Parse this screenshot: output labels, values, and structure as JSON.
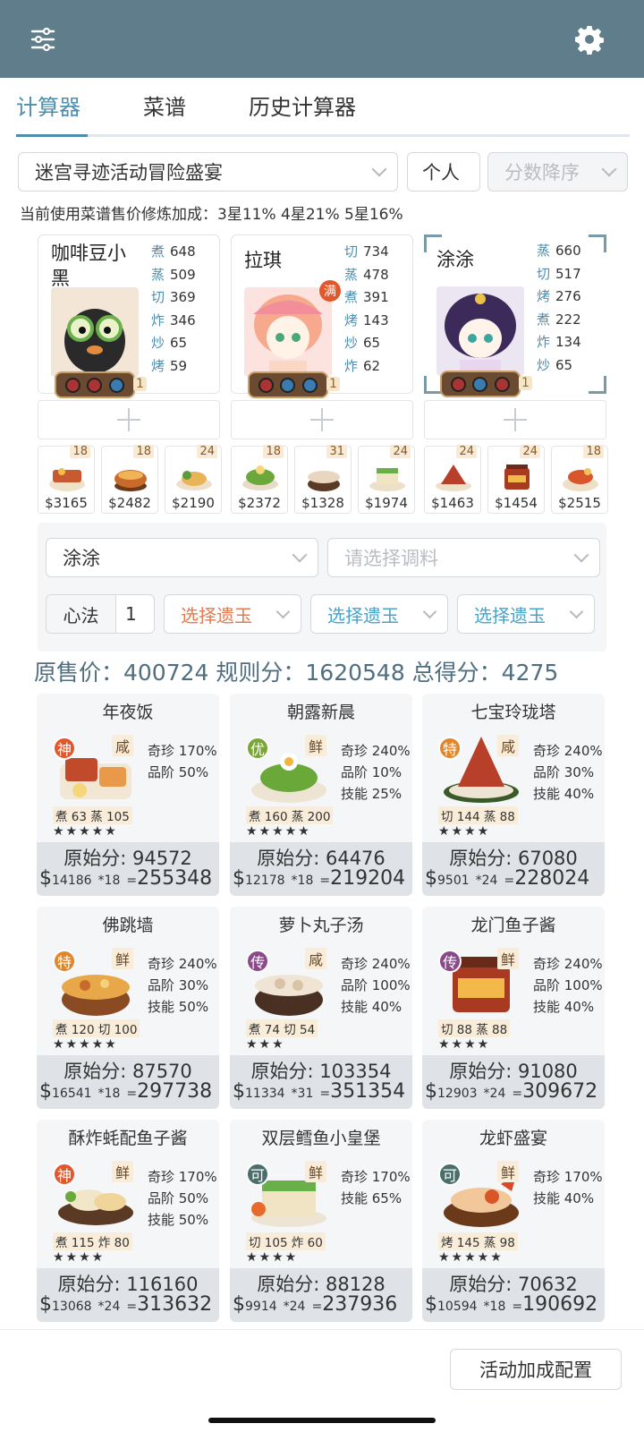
{
  "header": {
    "menu_icon": "sliders-icon",
    "settings_icon": "gear-icon"
  },
  "tabs": [
    "计算器",
    "菜谱",
    "历史计算器"
  ],
  "filters": {
    "event": "迷宫寻迹活动冒险盛宴",
    "mode": "个人",
    "sort": "分数降序"
  },
  "note": "当前使用菜谱售价修炼加成：3星11% 4星21% 5星16%",
  "chefs": [
    {
      "name": "咖啡豆小黑",
      "level": "1",
      "skills": [
        {
          "k": "煮",
          "v": "648"
        },
        {
          "k": "蒸",
          "v": "509"
        },
        {
          "k": "切",
          "v": "369"
        },
        {
          "k": "炸",
          "v": "346"
        },
        {
          "k": "炒",
          "v": "65"
        },
        {
          "k": "烤",
          "v": "59"
        }
      ]
    },
    {
      "name": "拉琪",
      "level": "1",
      "badge": "满",
      "skills": [
        {
          "k": "切",
          "v": "734"
        },
        {
          "k": "蒸",
          "v": "478"
        },
        {
          "k": "煮",
          "v": "391"
        },
        {
          "k": "烤",
          "v": "143"
        },
        {
          "k": "炒",
          "v": "65"
        },
        {
          "k": "炸",
          "v": "62"
        }
      ]
    },
    {
      "name": "涂涂",
      "level": "1",
      "skills": [
        {
          "k": "蒸",
          "v": "660"
        },
        {
          "k": "切",
          "v": "517"
        },
        {
          "k": "烤",
          "v": "276"
        },
        {
          "k": "煮",
          "v": "222"
        },
        {
          "k": "炸",
          "v": "134"
        },
        {
          "k": "炒",
          "v": "65"
        }
      ]
    }
  ],
  "recipes": [
    {
      "count": "18",
      "price": "$3165"
    },
    {
      "count": "18",
      "price": "$2482"
    },
    {
      "count": "24",
      "price": "$2190"
    },
    {
      "count": "18",
      "price": "$2372"
    },
    {
      "count": "31",
      "price": "$1328"
    },
    {
      "count": "24",
      "price": "$1974"
    },
    {
      "count": "24",
      "price": "$1463"
    },
    {
      "count": "24",
      "price": "$1454"
    },
    {
      "count": "18",
      "price": "$2515"
    }
  ],
  "panel": {
    "chef": "涂涂",
    "condiment_placeholder": "请选择调料",
    "xinfa_label": "心法",
    "xinfa_value": "1",
    "relic1": "选择遗玉",
    "relic2": "选择遗玉",
    "relic3": "选择遗玉"
  },
  "summary": "原售价：400724 规则分：1620548 总得分：4275",
  "dishes": [
    {
      "name": "年夜饭",
      "rarity": "神",
      "taste": "咸",
      "bonus": [
        "奇珍 170%",
        "品阶 50%"
      ],
      "skills": "煮 63 蒸 105",
      "stars": "★★★★★",
      "orig": "原始分: 94572",
      "unit": "14186",
      "mult": "*18",
      "total": "255348"
    },
    {
      "name": "朝露新晨",
      "rarity": "优",
      "taste": "鲜",
      "bonus": [
        "奇珍 240%",
        "品阶 10%",
        "技能 25%"
      ],
      "skills": "煮 160 蒸 200",
      "stars": "★★★★★",
      "orig": "原始分: 64476",
      "unit": "12178",
      "mult": "*18",
      "total": "219204"
    },
    {
      "name": "七宝玲珑塔",
      "rarity": "特",
      "taste": "咸",
      "bonus": [
        "奇珍 240%",
        "品阶 30%",
        "技能 40%"
      ],
      "skills": "切 144 蒸 88",
      "stars": "★★★★",
      "orig": "原始分: 67080",
      "unit": "9501",
      "mult": "*24",
      "total": "228024"
    },
    {
      "name": "佛跳墙",
      "rarity": "特",
      "taste": "鲜",
      "bonus": [
        "奇珍 240%",
        "品阶 30%",
        "技能 50%"
      ],
      "skills": "煮 120 切 100",
      "stars": "★★★★★",
      "orig": "原始分: 87570",
      "unit": "16541",
      "mult": "*18",
      "total": "297738"
    },
    {
      "name": "萝卜丸子汤",
      "rarity": "传",
      "taste": "咸",
      "bonus": [
        "奇珍 240%",
        "品阶 100%",
        "技能 40%"
      ],
      "skills": "煮 74 切 54",
      "stars": "★★★",
      "orig": "原始分: 103354",
      "unit": "11334",
      "mult": "*31",
      "total": "351354"
    },
    {
      "name": "龙门鱼子酱",
      "rarity": "传",
      "taste": "鲜",
      "bonus": [
        "奇珍 240%",
        "品阶 100%",
        "技能 40%"
      ],
      "skills": "切 88 蒸 88",
      "stars": "★★★★",
      "orig": "原始分: 91080",
      "unit": "12903",
      "mult": "*24",
      "total": "309672"
    },
    {
      "name": "酥炸蚝配鱼子酱",
      "rarity": "神",
      "taste": "鲜",
      "bonus": [
        "奇珍 170%",
        "品阶 50%",
        "技能 50%"
      ],
      "skills": "煮 115 炸 80",
      "stars": "★★★★",
      "orig": "原始分: 116160",
      "unit": "13068",
      "mult": "*24",
      "total": "313632"
    },
    {
      "name": "双层鳕鱼小皇堡",
      "rarity": "可",
      "taste": "鲜",
      "bonus": [
        "奇珍 170%",
        "技能 65%"
      ],
      "skills": "切 105 炸 60",
      "stars": "★★★★",
      "orig": "原始分: 88128",
      "unit": "9914",
      "mult": "*24",
      "total": "237936"
    },
    {
      "name": "龙虾盛宴",
      "rarity": "可",
      "taste": "鲜",
      "bonus": [
        "奇珍 170%",
        "技能 40%"
      ],
      "skills": "烤 145 蒸 98",
      "stars": "★★★★★",
      "orig": "原始分: 70632",
      "unit": "10594",
      "mult": "*18",
      "total": "190692"
    }
  ],
  "footer": {
    "button": "活动加成配置"
  },
  "colors": {
    "header": "#607d8b",
    "accent": "#4d8dae",
    "rarity_shen": "#e2572b",
    "rarity_you": "#7aa637",
    "rarity_te": "#e0862b",
    "rarity_chuan": "#8a4a8a",
    "rarity_ke": "#4a6e6a"
  }
}
